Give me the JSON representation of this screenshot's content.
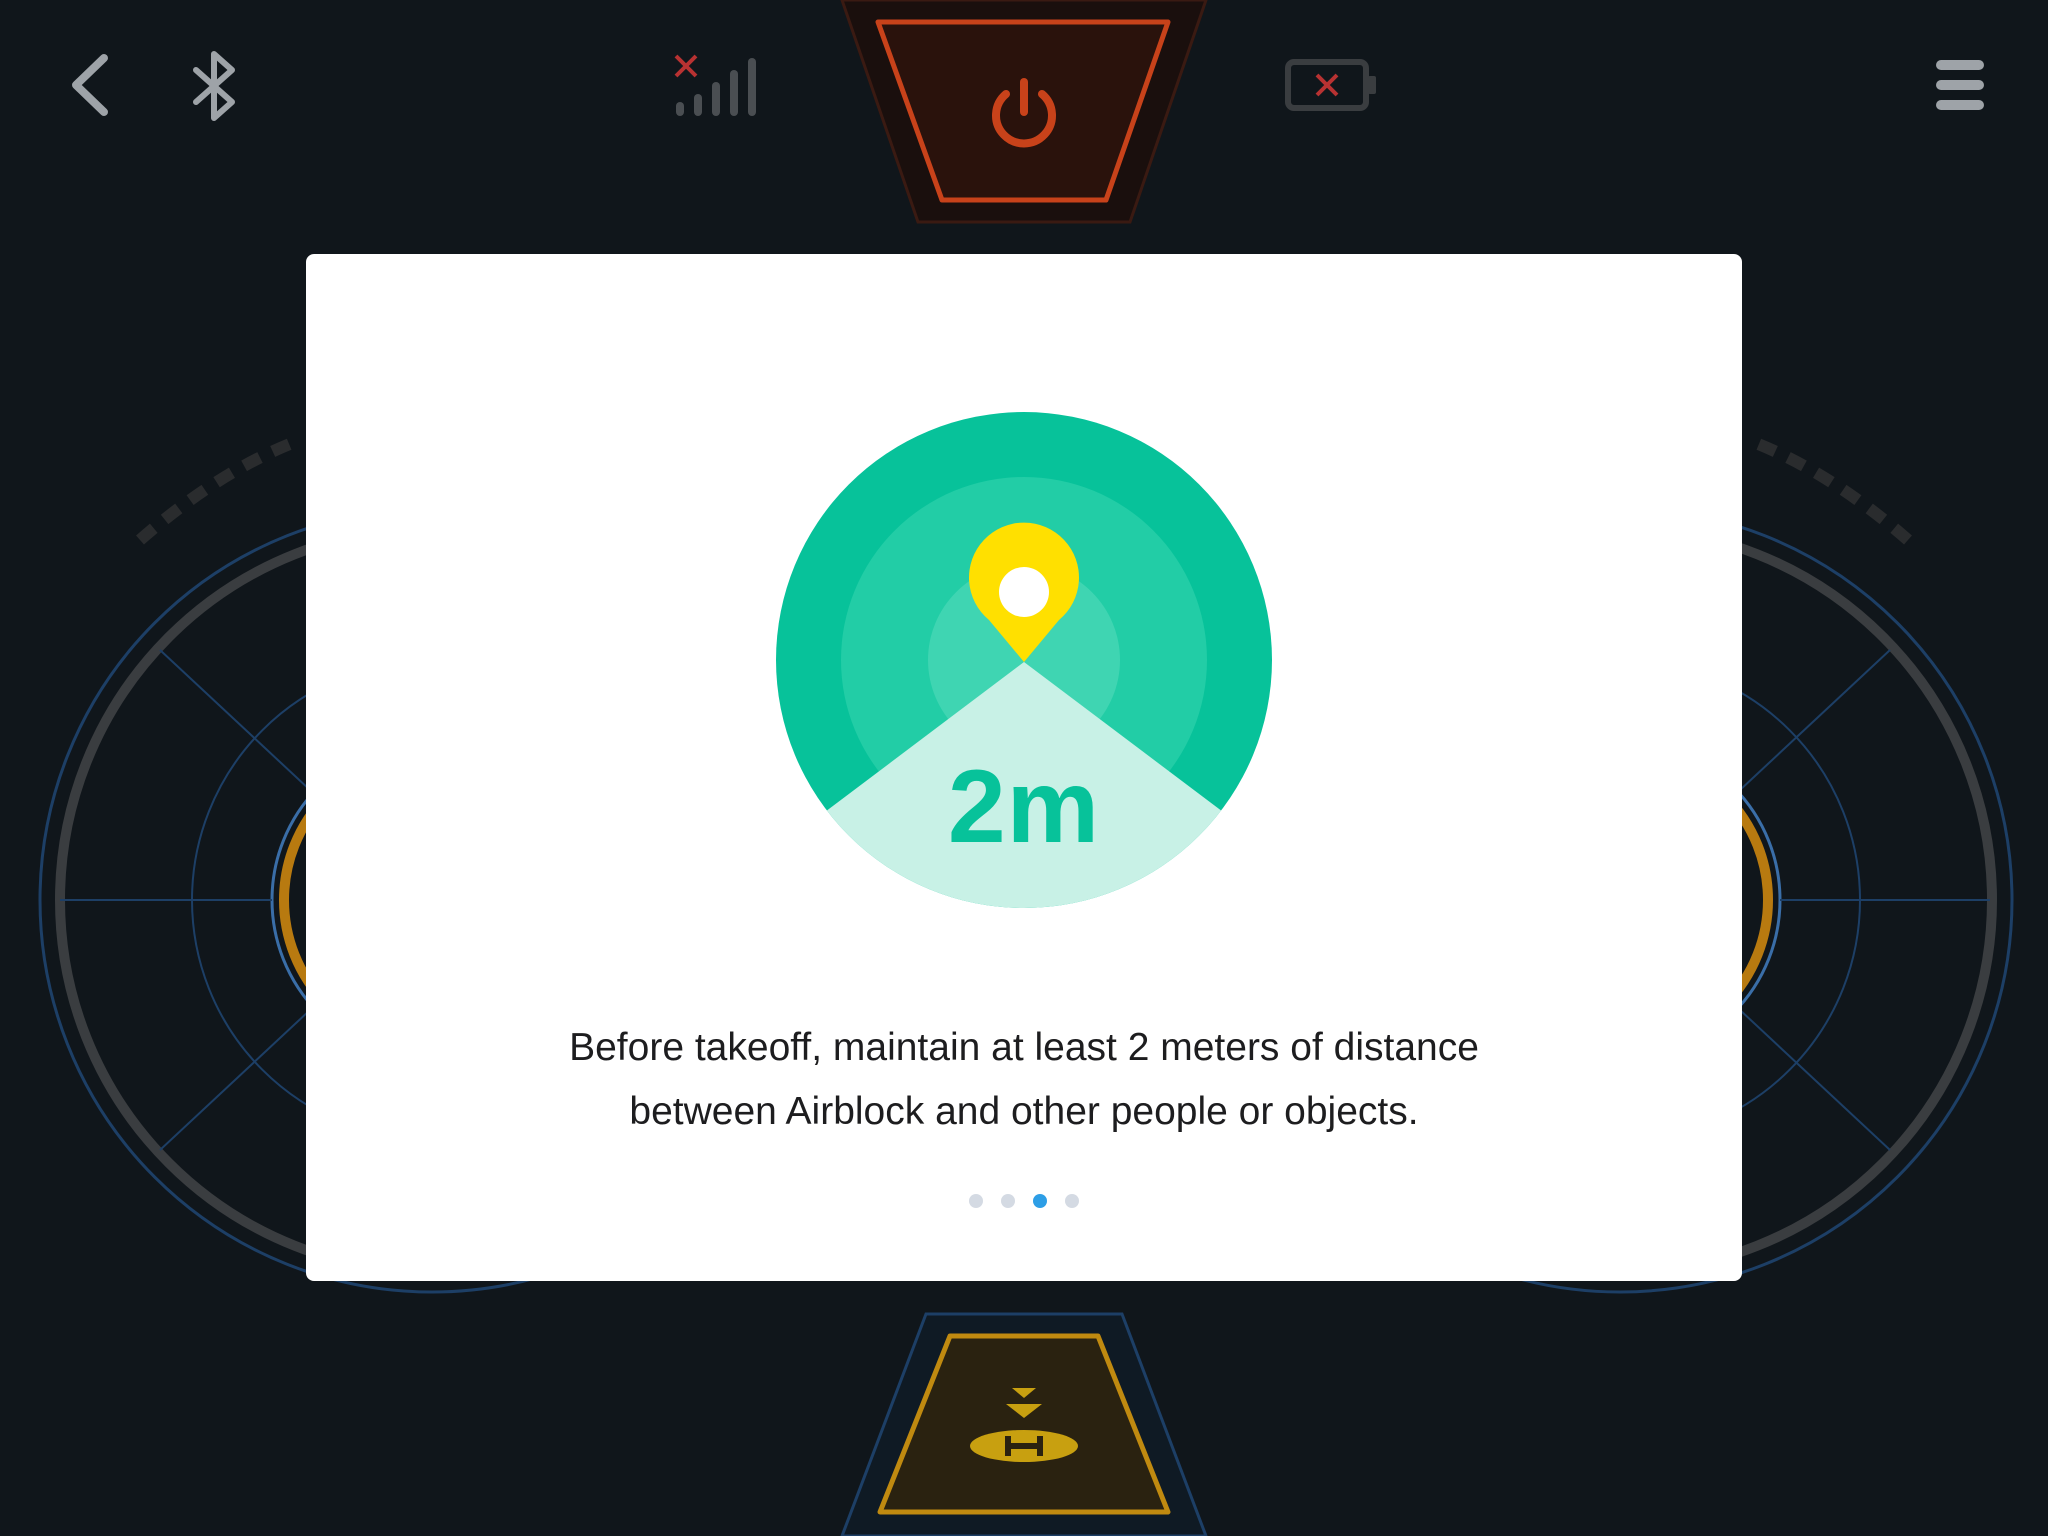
{
  "topbar": {
    "back_icon": "chevron-left-icon",
    "bluetooth_icon": "bluetooth-icon",
    "signal_icon": "no-signal-icon",
    "power_icon": "power-icon",
    "battery_icon": "battery-error-icon",
    "menu_icon": "hamburger-menu-icon"
  },
  "landing_icon": "helipad-land-icon",
  "dialog": {
    "illustration_icon": "location-pin-icon",
    "distance_label": "2m",
    "message_lines": [
      "Before takeoff, maintain at least 2 meters of distance",
      "between Airblock and other people or objects."
    ],
    "pager": {
      "total": 4,
      "current": 3
    }
  },
  "colors": {
    "background": "#10161b",
    "accent_green": "#07c29a",
    "pin_yellow": "#ffe000",
    "power_red": "#c8421a",
    "land_orange": "#c08a10",
    "pager_active": "#2d9ee6"
  }
}
